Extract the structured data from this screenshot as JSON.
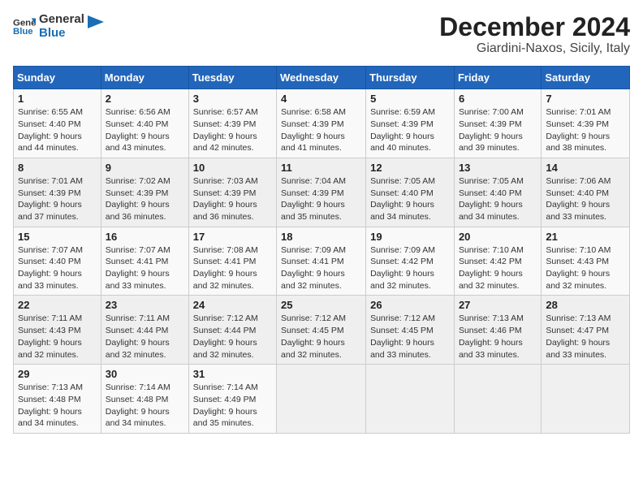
{
  "header": {
    "logo_line1": "General",
    "logo_line2": "Blue",
    "title": "December 2024",
    "subtitle": "Giardini-Naxos, Sicily, Italy"
  },
  "weekdays": [
    "Sunday",
    "Monday",
    "Tuesday",
    "Wednesday",
    "Thursday",
    "Friday",
    "Saturday"
  ],
  "weeks": [
    [
      {
        "day": "1",
        "sunrise": "6:55 AM",
        "sunset": "4:40 PM",
        "daylight": "9 hours and 44 minutes."
      },
      {
        "day": "2",
        "sunrise": "6:56 AM",
        "sunset": "4:40 PM",
        "daylight": "9 hours and 43 minutes."
      },
      {
        "day": "3",
        "sunrise": "6:57 AM",
        "sunset": "4:39 PM",
        "daylight": "9 hours and 42 minutes."
      },
      {
        "day": "4",
        "sunrise": "6:58 AM",
        "sunset": "4:39 PM",
        "daylight": "9 hours and 41 minutes."
      },
      {
        "day": "5",
        "sunrise": "6:59 AM",
        "sunset": "4:39 PM",
        "daylight": "9 hours and 40 minutes."
      },
      {
        "day": "6",
        "sunrise": "7:00 AM",
        "sunset": "4:39 PM",
        "daylight": "9 hours and 39 minutes."
      },
      {
        "day": "7",
        "sunrise": "7:01 AM",
        "sunset": "4:39 PM",
        "daylight": "9 hours and 38 minutes."
      }
    ],
    [
      {
        "day": "8",
        "sunrise": "7:01 AM",
        "sunset": "4:39 PM",
        "daylight": "9 hours and 37 minutes."
      },
      {
        "day": "9",
        "sunrise": "7:02 AM",
        "sunset": "4:39 PM",
        "daylight": "9 hours and 36 minutes."
      },
      {
        "day": "10",
        "sunrise": "7:03 AM",
        "sunset": "4:39 PM",
        "daylight": "9 hours and 36 minutes."
      },
      {
        "day": "11",
        "sunrise": "7:04 AM",
        "sunset": "4:39 PM",
        "daylight": "9 hours and 35 minutes."
      },
      {
        "day": "12",
        "sunrise": "7:05 AM",
        "sunset": "4:40 PM",
        "daylight": "9 hours and 34 minutes."
      },
      {
        "day": "13",
        "sunrise": "7:05 AM",
        "sunset": "4:40 PM",
        "daylight": "9 hours and 34 minutes."
      },
      {
        "day": "14",
        "sunrise": "7:06 AM",
        "sunset": "4:40 PM",
        "daylight": "9 hours and 33 minutes."
      }
    ],
    [
      {
        "day": "15",
        "sunrise": "7:07 AM",
        "sunset": "4:40 PM",
        "daylight": "9 hours and 33 minutes."
      },
      {
        "day": "16",
        "sunrise": "7:07 AM",
        "sunset": "4:41 PM",
        "daylight": "9 hours and 33 minutes."
      },
      {
        "day": "17",
        "sunrise": "7:08 AM",
        "sunset": "4:41 PM",
        "daylight": "9 hours and 32 minutes."
      },
      {
        "day": "18",
        "sunrise": "7:09 AM",
        "sunset": "4:41 PM",
        "daylight": "9 hours and 32 minutes."
      },
      {
        "day": "19",
        "sunrise": "7:09 AM",
        "sunset": "4:42 PM",
        "daylight": "9 hours and 32 minutes."
      },
      {
        "day": "20",
        "sunrise": "7:10 AM",
        "sunset": "4:42 PM",
        "daylight": "9 hours and 32 minutes."
      },
      {
        "day": "21",
        "sunrise": "7:10 AM",
        "sunset": "4:43 PM",
        "daylight": "9 hours and 32 minutes."
      }
    ],
    [
      {
        "day": "22",
        "sunrise": "7:11 AM",
        "sunset": "4:43 PM",
        "daylight": "9 hours and 32 minutes."
      },
      {
        "day": "23",
        "sunrise": "7:11 AM",
        "sunset": "4:44 PM",
        "daylight": "9 hours and 32 minutes."
      },
      {
        "day": "24",
        "sunrise": "7:12 AM",
        "sunset": "4:44 PM",
        "daylight": "9 hours and 32 minutes."
      },
      {
        "day": "25",
        "sunrise": "7:12 AM",
        "sunset": "4:45 PM",
        "daylight": "9 hours and 32 minutes."
      },
      {
        "day": "26",
        "sunrise": "7:12 AM",
        "sunset": "4:45 PM",
        "daylight": "9 hours and 33 minutes."
      },
      {
        "day": "27",
        "sunrise": "7:13 AM",
        "sunset": "4:46 PM",
        "daylight": "9 hours and 33 minutes."
      },
      {
        "day": "28",
        "sunrise": "7:13 AM",
        "sunset": "4:47 PM",
        "daylight": "9 hours and 33 minutes."
      }
    ],
    [
      {
        "day": "29",
        "sunrise": "7:13 AM",
        "sunset": "4:48 PM",
        "daylight": "9 hours and 34 minutes."
      },
      {
        "day": "30",
        "sunrise": "7:14 AM",
        "sunset": "4:48 PM",
        "daylight": "9 hours and 34 minutes."
      },
      {
        "day": "31",
        "sunrise": "7:14 AM",
        "sunset": "4:49 PM",
        "daylight": "9 hours and 35 minutes."
      },
      null,
      null,
      null,
      null
    ]
  ],
  "labels": {
    "sunrise": "Sunrise:",
    "sunset": "Sunset:",
    "daylight": "Daylight:"
  }
}
